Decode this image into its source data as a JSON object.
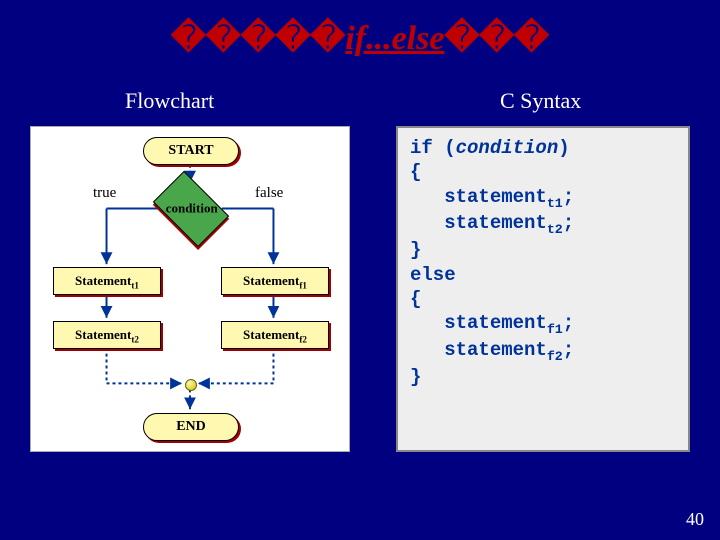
{
  "title": {
    "left_boxes": "�����",
    "mid": "if...else",
    "right_boxes": "���"
  },
  "labels": {
    "flowchart": "Flowchart",
    "csyntax": "C Syntax"
  },
  "flowchart": {
    "start": "START",
    "end": "END",
    "condition": "condition",
    "true": "true",
    "false": "false",
    "stmt_t1": "Statement",
    "stmt_t1_sub": "t1",
    "stmt_t2": "Statement",
    "stmt_t2_sub": "t2",
    "stmt_f1": "Statement",
    "stmt_f1_sub": "f1",
    "stmt_f2": "Statement",
    "stmt_f2_sub": "f2"
  },
  "code": {
    "l1a": "if (",
    "l1b": "condition",
    "l1c": ")",
    "l2": "{",
    "l3a": "   statement",
    "l3b": "t1",
    "l3c": ";",
    "l4a": "   statement",
    "l4b": "t2",
    "l4c": ";",
    "l5": "}",
    "l6": "else",
    "l7": "{",
    "l8a": "   statement",
    "l8b": "f1",
    "l8c": ";",
    "l9a": "   statement",
    "l9b": "f2",
    "l9c": ";",
    "l10": "}"
  },
  "page": "40"
}
